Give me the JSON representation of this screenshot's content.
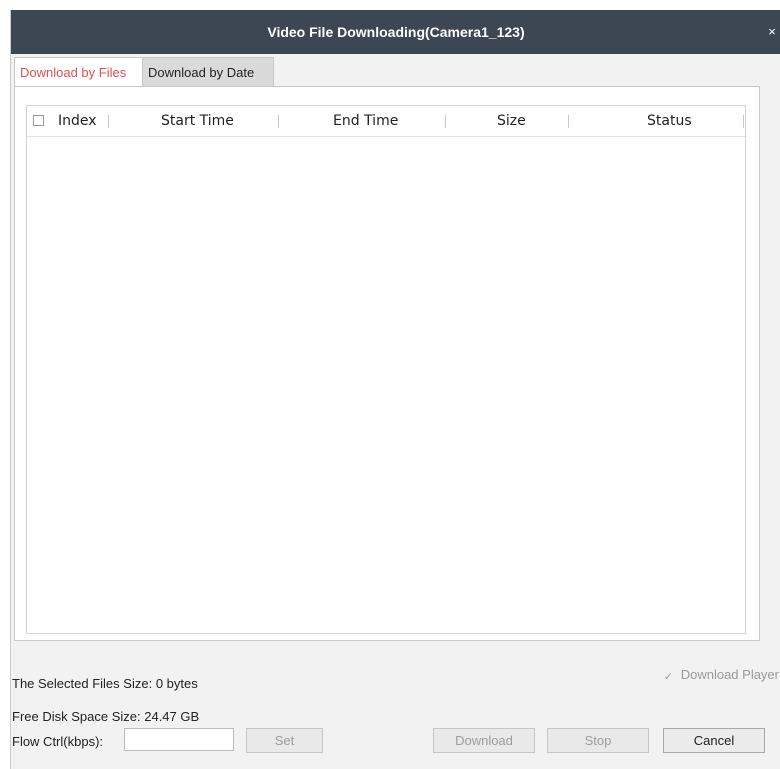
{
  "dialog": {
    "title": "Video File Downloading(Camera1_123)",
    "close_glyph": "×"
  },
  "tabs": [
    {
      "label": "Download by Files",
      "active": true
    },
    {
      "label": "Download by Date",
      "active": false
    }
  ],
  "table": {
    "columns": [
      "Index",
      "Start Time",
      "End Time",
      "Size",
      "Status"
    ],
    "rows": []
  },
  "info": {
    "selected_size_label": "The Selected Files Size:",
    "selected_size_value": "0 bytes",
    "free_space_label": "Free Disk Space Size:",
    "free_space_value": "24.47 GB",
    "flow_label": "Flow Ctrl(kbps):",
    "flow_value": ""
  },
  "download_player": {
    "label": "Download Player",
    "checked": true,
    "enabled": false
  },
  "buttons": {
    "set": "Set",
    "download": "Download",
    "stop": "Stop",
    "cancel": "Cancel"
  },
  "colors": {
    "titlebar": "#3d4753",
    "active_tab_text": "#d9534f",
    "background": "#f2f2f2"
  }
}
